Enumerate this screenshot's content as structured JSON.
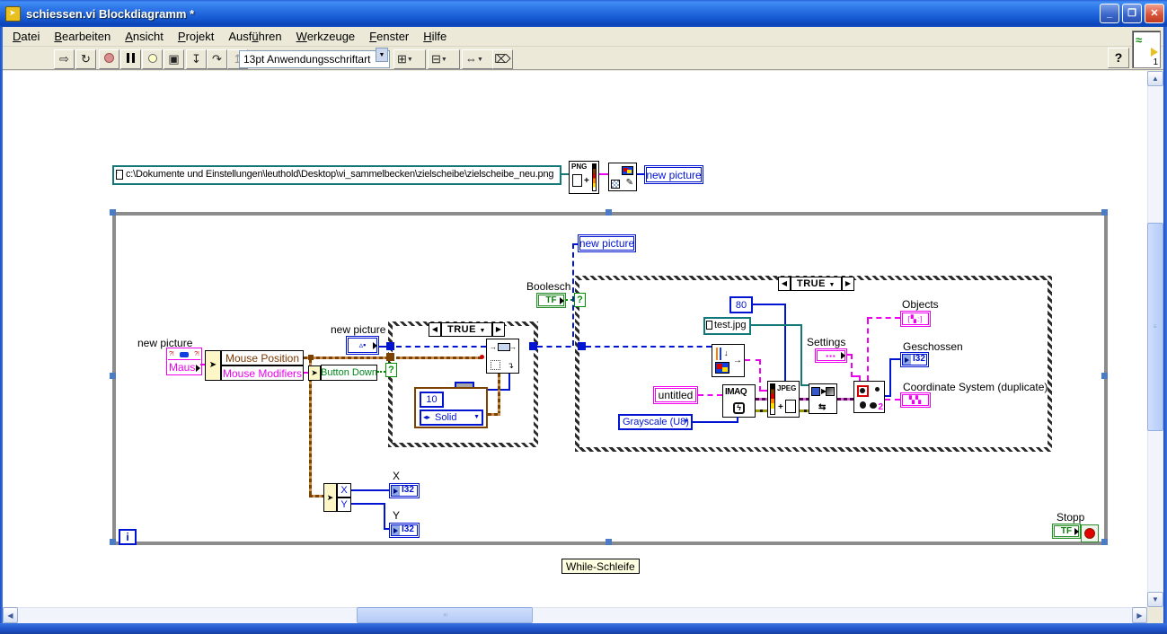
{
  "window": {
    "title": "schiessen.vi Blockdiagramm *"
  },
  "menu": {
    "items": [
      {
        "pre": "",
        "u": "D",
        "rest": "atei"
      },
      {
        "pre": "",
        "u": "B",
        "rest": "earbeiten"
      },
      {
        "pre": "",
        "u": "A",
        "rest": "nsicht"
      },
      {
        "pre": "",
        "u": "P",
        "rest": "rojekt"
      },
      {
        "pre": "Ausf",
        "u": "ü",
        "rest": "hren"
      },
      {
        "pre": "",
        "u": "W",
        "rest": "erkzeuge"
      },
      {
        "pre": "",
        "u": "F",
        "rest": "enster"
      },
      {
        "pre": "",
        "u": "H",
        "rest": "ilfe"
      }
    ]
  },
  "toolbar": {
    "font_selector": "13pt Anwendungsschriftart",
    "help": "?",
    "vi_badge": "1"
  },
  "diagram": {
    "path_constant": "c:\\Dokumente und Einstellungen\\leuthold\\Desktop\\vi_sammelbecken\\zielscheibe\\zielscheibe_neu.png",
    "png_label": "PNG",
    "new_picture": "new picture",
    "maus": "Maus",
    "mouse_position": "Mouse Position",
    "mouse_modifiers": "Mouse Modifiers",
    "button_down": "Button Down",
    "boolesch": "Boolesch",
    "case_selector": "TRUE",
    "pen_size": "10",
    "pen_style": "Solid",
    "quality": "80",
    "test_jpg": "test.jpg",
    "untitled": "untitled",
    "imaq": "IMAQ",
    "grayscale": "Grayscale (U8)",
    "jpeg": "JPEG",
    "settings": "Settings",
    "objects": "Objects",
    "geschossen": "Geschossen",
    "coordinate_system": "Coordinate System (duplicate)",
    "i32": "I32",
    "x_label": "X",
    "y_label": "Y",
    "iteration": "i",
    "tf": "TF",
    "stopp": "Stopp",
    "while_label": "While-Schleife",
    "question": "?"
  },
  "colors": {
    "titlebar_blue": "#2a62d8",
    "panel_beige": "#ece9d8",
    "wire_pink": "#ef00ef",
    "wire_blue": "#0014d2",
    "wire_teal": "#147878",
    "wire_green": "#009000",
    "wire_brown": "#7b4200",
    "wire_purple": "#5c005c",
    "wire_error_yellow": "#9a9a00",
    "boolean_green": "#2a8f2a",
    "loop_gray": "#8c8c8c",
    "selection_blue": "#4d7cc7",
    "stop_red": "#e00000"
  }
}
